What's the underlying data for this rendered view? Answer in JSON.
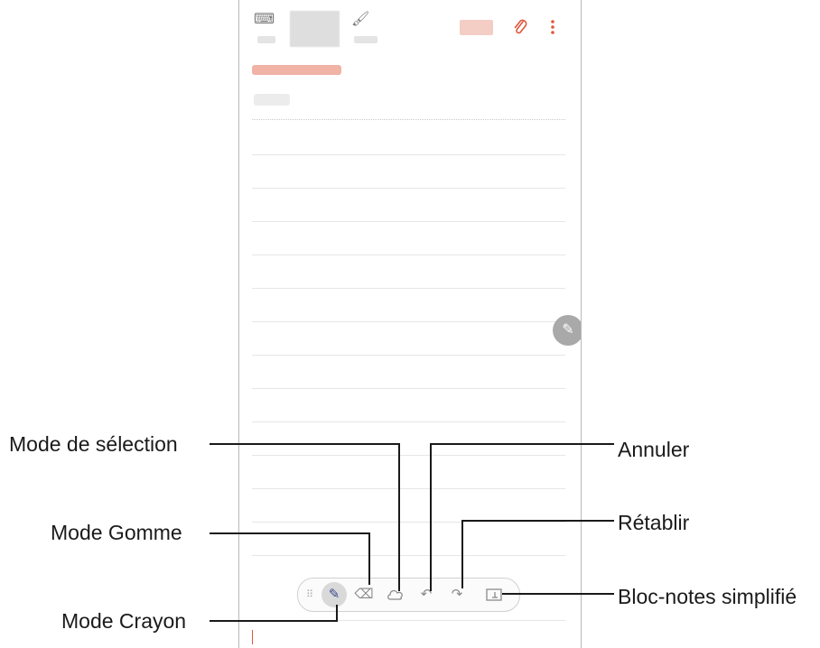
{
  "diagram": {
    "callouts": {
      "selection_mode": "Mode de sélection",
      "eraser_mode": "Mode Gomme",
      "pen_mode": "Mode Crayon",
      "undo": "Annuler",
      "redo": "Rétablir",
      "easy_writing_pad": "Bloc-notes simplifié"
    }
  },
  "icons": {
    "keyboard": "keyboard-icon",
    "brush": "brush-icon",
    "attach": "paperclip-icon",
    "more": "more-options-icon",
    "pen_fab": "pen-icon",
    "drag": "drag-handle-icon",
    "pen": "pen-mode-icon",
    "eraser": "eraser-icon",
    "selection": "selection-lasso-icon",
    "undo": "undo-icon",
    "redo": "redo-icon",
    "writing_pad": "writing-pad-icon"
  },
  "colors": {
    "accent_title": "#f0b3a6",
    "save_button": "#f4cdc5",
    "attach_icon": "#e0563c",
    "leader_line": "#1a1a1a"
  }
}
